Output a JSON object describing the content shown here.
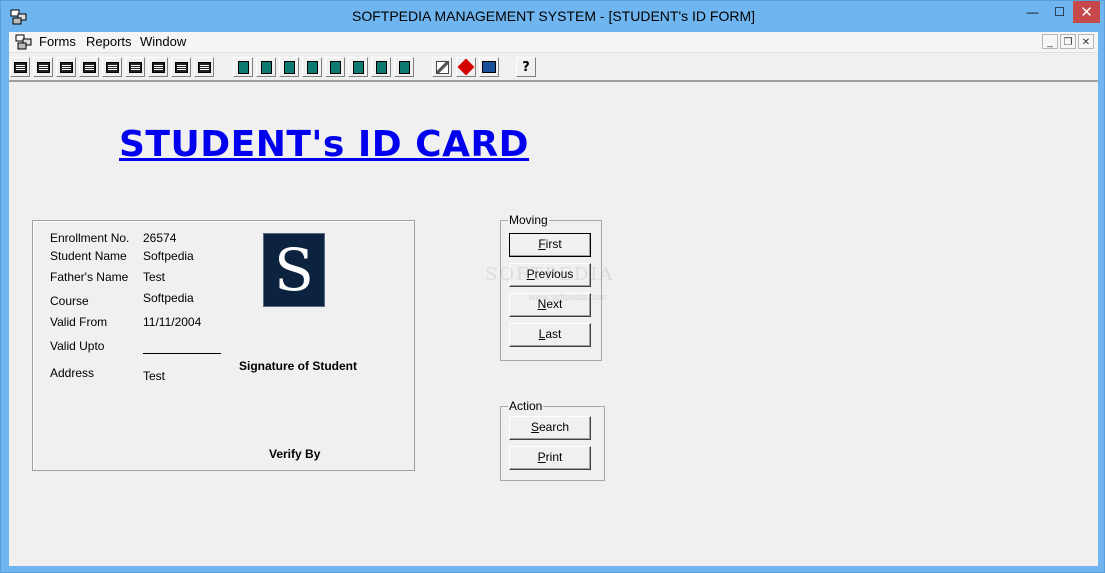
{
  "window": {
    "title": "SOFTPEDIA MANAGEMENT SYSTEM - [STUDENT's ID FORM]",
    "controls": {
      "minimize": "—",
      "maximize": "☐",
      "close": "✕"
    }
  },
  "menu": {
    "items": [
      "Forms",
      "Reports",
      "Window"
    ],
    "mdi_controls": {
      "minimize": "_",
      "restore": "❐",
      "close": "✕"
    }
  },
  "toolbar": {
    "form_buttons": [
      "form-icon",
      "form-icon",
      "form-icon",
      "form-icon",
      "form-icon",
      "form-icon",
      "form-icon",
      "form-icon",
      "form-icon"
    ],
    "report_buttons": [
      "report-icon",
      "report-icon",
      "report-icon",
      "report-icon",
      "report-icon",
      "report-icon",
      "report-icon",
      "report-icon"
    ],
    "tool_buttons": [
      "tools-icon",
      "book-icon",
      "chart-icon"
    ],
    "help_button": {
      "icon": "help-icon",
      "glyph": "?"
    }
  },
  "heading": "STUDENT's ID CARD",
  "card": {
    "enrollment_label": "Enrollment No.",
    "enrollment_value": "26574",
    "student_label": "Student Name",
    "student_value": "Softpedia",
    "father_label": "Father's Name",
    "father_value": "Test",
    "course_label": "Course",
    "course_value": "Softpedia",
    "valid_from_label": "Valid From",
    "valid_from_value": "11/11/2004",
    "valid_upto_label": "Valid Upto",
    "address_label": "Address",
    "address_value": "Test",
    "photo_letter": "S",
    "signature_label": "Signature of Student",
    "verify_label": "Verify By"
  },
  "moving": {
    "title": "Moving",
    "first": {
      "u": "F",
      "rest": "irst"
    },
    "previous": {
      "u": "P",
      "rest": "revious"
    },
    "next": {
      "u": "N",
      "rest": "ext"
    },
    "last": {
      "u": "L",
      "rest": "ast"
    }
  },
  "action": {
    "title": "Action",
    "search": {
      "u": "S",
      "rest": "earch"
    },
    "print": {
      "u": "P",
      "rest": "rint"
    }
  },
  "watermark": {
    "main": "SOFTPEDIA",
    "sub": "www.softpedia.com"
  },
  "colors": {
    "heading": "#0000ee",
    "window_frame": "#6fb6f0",
    "close_button": "#c7484a",
    "photo_bg": "#0c2340"
  }
}
